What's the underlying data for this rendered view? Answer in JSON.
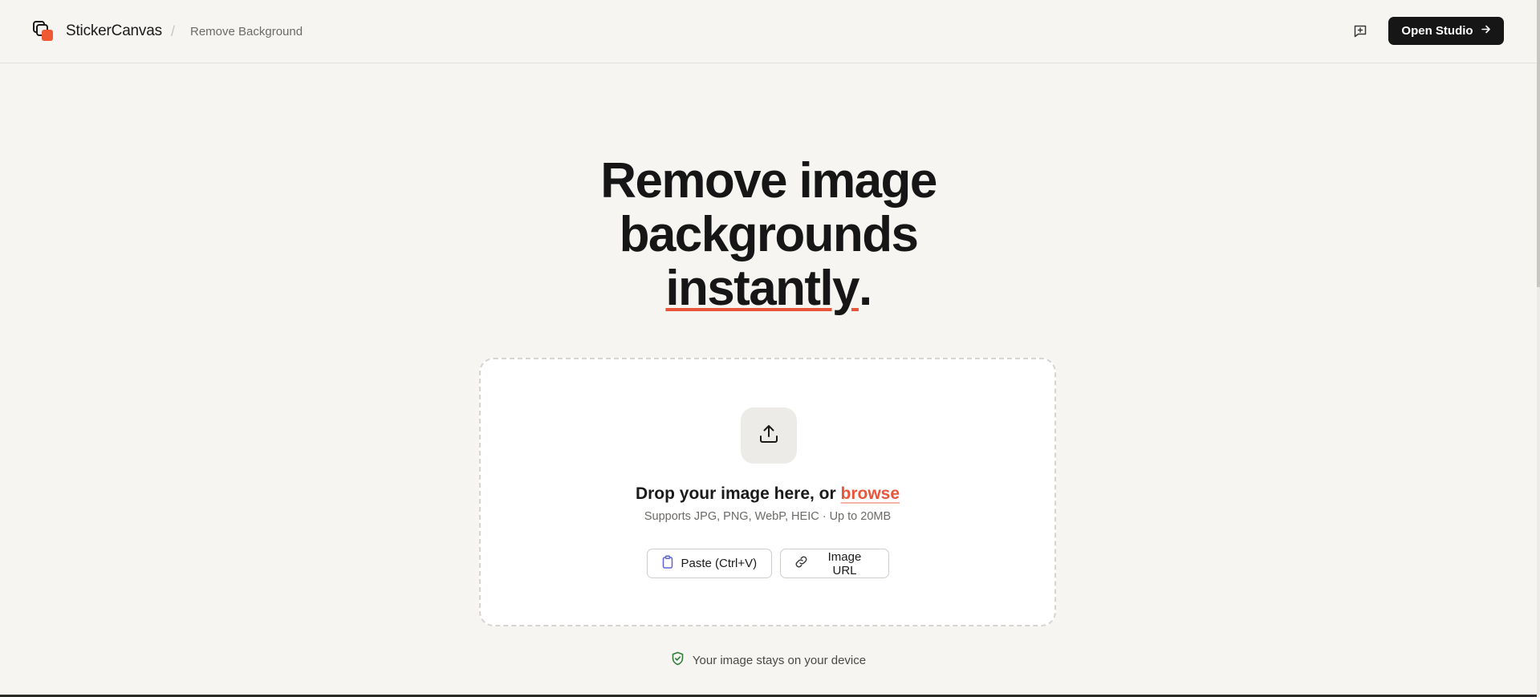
{
  "header": {
    "brand_name": "StickerCanvas",
    "separator": "/",
    "breadcrumb_current": "Remove Background",
    "feedback_icon": "message-plus-icon",
    "open_studio_label": "Open Studio",
    "open_studio_icon": "arrow-right-icon"
  },
  "hero": {
    "line1": "Remove image",
    "line2": "backgrounds",
    "accent_word": "instantly",
    "accent_punct": ".",
    "accent_color": "#e8553a"
  },
  "dropzone": {
    "upload_icon": "upload-icon",
    "drop_text": "Drop your image here, or",
    "browse_label": "browse",
    "supports_text": "Supports JPG, PNG, WebP, HEIC · Up to 20MB",
    "paste_label": "Paste (Ctrl+V)",
    "paste_icon": "clipboard-icon",
    "url_label": "Image URL",
    "url_icon": "link-icon"
  },
  "privacy": {
    "icon": "shield-check-icon",
    "text": "Your image stays on your device"
  },
  "colors": {
    "background": "#f6f5f2",
    "primary_dark": "#161616",
    "accent": "#e8553a",
    "privacy_green": "#2f7d3b"
  }
}
